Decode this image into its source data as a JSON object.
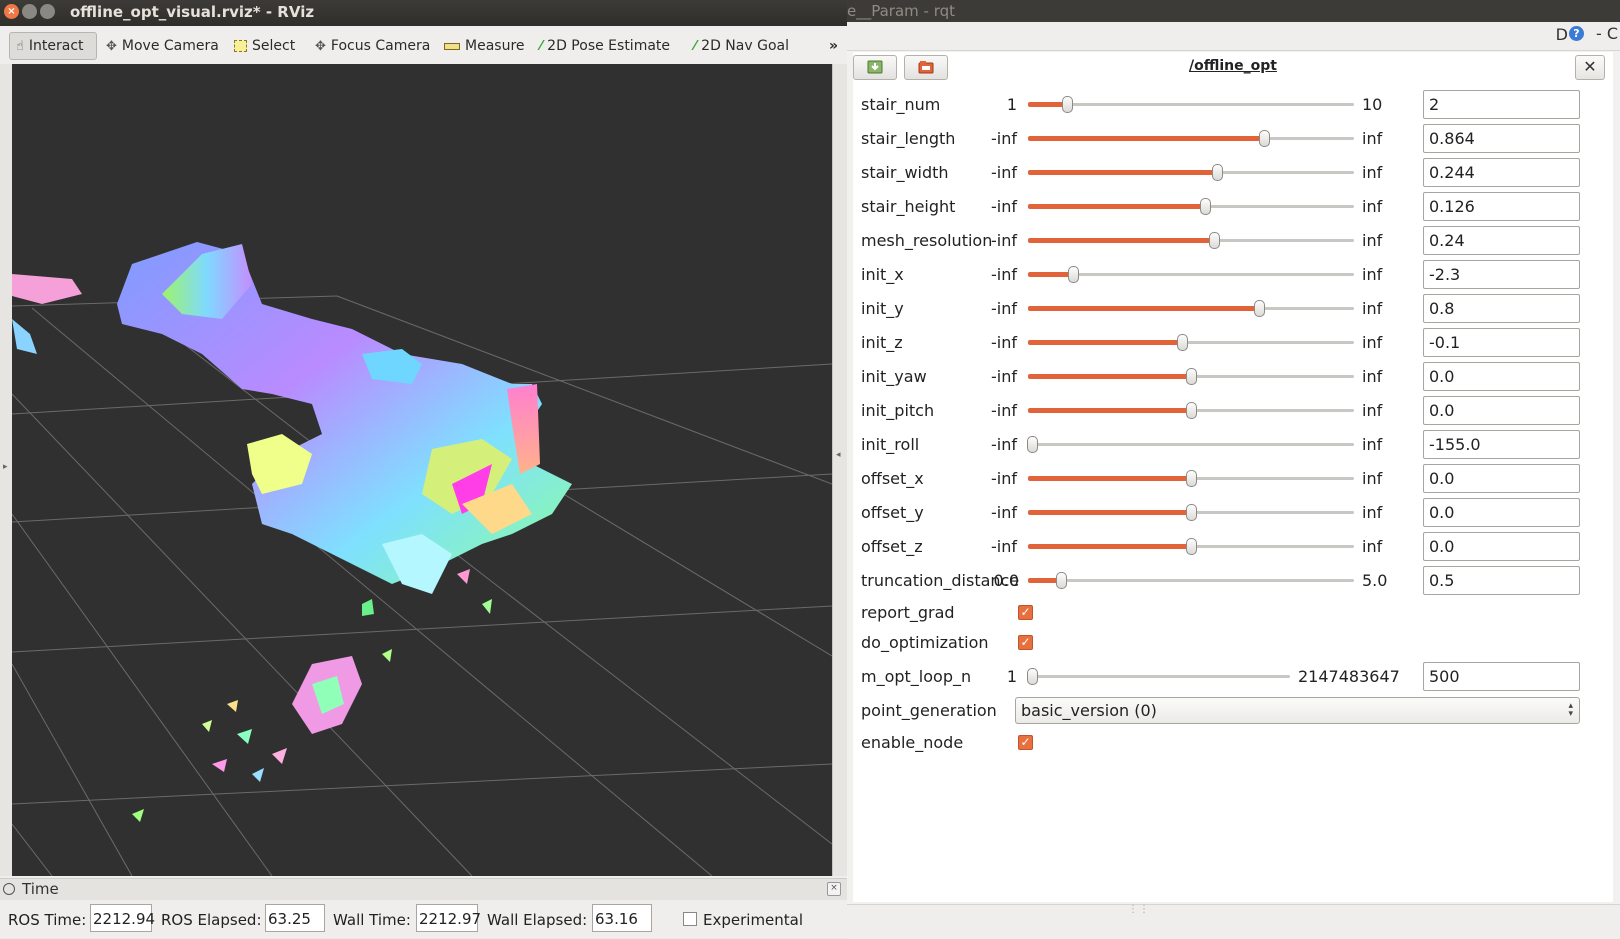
{
  "rviz": {
    "title": "offline_opt_visual.rviz* - RViz",
    "toolbar": [
      {
        "label": "Interact",
        "icon": "hand-icon"
      },
      {
        "label": "Move Camera",
        "icon": "move-camera-icon"
      },
      {
        "label": "Select",
        "icon": "select-icon"
      },
      {
        "label": "Focus Camera",
        "icon": "focus-camera-icon"
      },
      {
        "label": "Measure",
        "icon": "ruler-icon"
      },
      {
        "label": "2D Pose Estimate",
        "icon": "green-arrow-icon"
      },
      {
        "label": "2D Nav Goal",
        "icon": "green-arrow-icon"
      }
    ],
    "overflow": "»",
    "time_panel": {
      "title": "Time",
      "ros_time_label": "ROS Time:",
      "ros_time": "2212.94",
      "ros_elapsed_label": "ROS Elapsed:",
      "ros_elapsed": "63.25",
      "wall_time_label": "Wall Time:",
      "wall_time": "2212.97",
      "wall_elapsed_label": "Wall Elapsed:",
      "wall_elapsed": "63.16",
      "experimental_label": "Experimental",
      "experimental_checked": false
    }
  },
  "rqt": {
    "title": "e__Param - rqt",
    "help_d": "D",
    "help_q": "?",
    "dash_label": "- C",
    "node": "/offline_opt",
    "params": [
      {
        "name": "stair_num",
        "min": "1",
        "max": "10",
        "value": "2",
        "position": 0.12
      },
      {
        "name": "stair_length",
        "min": "-inf",
        "max": "inf",
        "value": "0.864",
        "position": 0.725
      },
      {
        "name": "stair_width",
        "min": "-inf",
        "max": "inf",
        "value": "0.244",
        "position": 0.58
      },
      {
        "name": "stair_height",
        "min": "-inf",
        "max": "inf",
        "value": "0.126",
        "position": 0.542
      },
      {
        "name": "mesh_resolution",
        "min": "-inf",
        "max": "inf",
        "value": "0.24",
        "position": 0.572
      },
      {
        "name": "init_x",
        "min": "-inf",
        "max": "inf",
        "value": "-2.3",
        "position": 0.138
      },
      {
        "name": "init_y",
        "min": "-inf",
        "max": "inf",
        "value": "0.8",
        "position": 0.708
      },
      {
        "name": "init_z",
        "min": "-inf",
        "max": "inf",
        "value": "-0.1",
        "position": 0.473
      },
      {
        "name": "init_yaw",
        "min": "-inf",
        "max": "inf",
        "value": "0.0",
        "position": 0.5
      },
      {
        "name": "init_pitch",
        "min": "-inf",
        "max": "inf",
        "value": "0.0",
        "position": 0.5
      },
      {
        "name": "init_roll",
        "min": "-inf",
        "max": "inf",
        "value": "-155.0",
        "position": 0.012
      },
      {
        "name": "offset_x",
        "min": "-inf",
        "max": "inf",
        "value": "0.0",
        "position": 0.5
      },
      {
        "name": "offset_y",
        "min": "-inf",
        "max": "inf",
        "value": "0.0",
        "position": 0.5
      },
      {
        "name": "offset_z",
        "min": "-inf",
        "max": "inf",
        "value": "0.0",
        "position": 0.5
      },
      {
        "name": "truncation_distance",
        "min": "0.0",
        "max": "5.0",
        "value": "0.5",
        "position": 0.1
      }
    ],
    "bools_a": [
      {
        "name": "report_grad",
        "checked": true
      },
      {
        "name": "do_optimization",
        "checked": true
      }
    ],
    "loop": {
      "name": "m_opt_loop_n",
      "min": "1",
      "max": "2147483647",
      "value": "500",
      "position": 0.0
    },
    "enum": {
      "name": "point_generation",
      "value": "basic_version (0)"
    },
    "bools_b": [
      {
        "name": "enable_node",
        "checked": true
      }
    ]
  }
}
